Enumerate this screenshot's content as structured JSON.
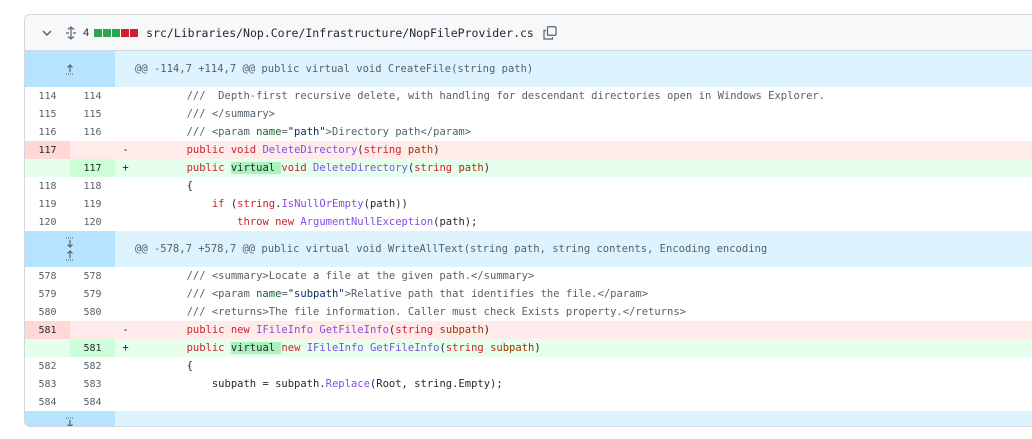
{
  "file": {
    "change_count": "4",
    "path": "src/Libraries/Nop.Core/Infrastructure/NopFileProvider.cs",
    "diffstat": [
      "add",
      "add",
      "add",
      "del",
      "del"
    ],
    "colors": {
      "add": "#2da44e",
      "del": "#cf222e",
      "hunk": "#ddf4ff"
    }
  },
  "hunks": [
    {
      "header": "@@ -114,7 +114,7 @@ public virtual void CreateFile(string path)",
      "lines": [
        {
          "type": "ctx",
          "old": "114",
          "new": "114",
          "marker": "",
          "tokens": [
            [
              "cm",
              "        ///  Depth-first recursive delete, with handling for descendant directories open in Windows Explorer."
            ]
          ]
        },
        {
          "type": "ctx",
          "old": "115",
          "new": "115",
          "marker": "",
          "tokens": [
            [
              "cm",
              "        /// </summary>"
            ]
          ]
        },
        {
          "type": "ctx",
          "old": "116",
          "new": "116",
          "marker": "",
          "tokens": [
            [
              "cm",
              "        /// <param "
            ],
            [
              "ent",
              "name"
            ],
            [
              "cm",
              "="
            ],
            [
              "str",
              "\"path\""
            ],
            [
              "cm",
              ">Directory path</param>"
            ]
          ]
        },
        {
          "type": "del",
          "old": "117",
          "new": "",
          "marker": "-",
          "tokens": [
            [
              "",
              "        "
            ],
            [
              "kw",
              "public"
            ],
            [
              "",
              " "
            ],
            [
              "kw",
              "void"
            ],
            [
              "",
              " "
            ],
            [
              "fn",
              "DeleteDirectory"
            ],
            [
              "",
              "("
            ],
            [
              "kw",
              "string"
            ],
            [
              "",
              " "
            ],
            [
              "ident",
              "path"
            ],
            [
              "",
              ")"
            ]
          ]
        },
        {
          "type": "add",
          "old": "",
          "new": "117",
          "marker": "+",
          "tokens": [
            [
              "",
              "        "
            ],
            [
              "kw",
              "public"
            ],
            [
              "",
              " "
            ],
            [
              "hl",
              "virtual "
            ],
            [
              "kw",
              "void"
            ],
            [
              "",
              " "
            ],
            [
              "fn",
              "DeleteDirectory"
            ],
            [
              "",
              "("
            ],
            [
              "kw",
              "string"
            ],
            [
              "",
              " "
            ],
            [
              "ident",
              "path"
            ],
            [
              "",
              ")"
            ]
          ]
        },
        {
          "type": "ctx",
          "old": "118",
          "new": "118",
          "marker": "",
          "tokens": [
            [
              "",
              "        {"
            ]
          ]
        },
        {
          "type": "ctx",
          "old": "119",
          "new": "119",
          "marker": "",
          "tokens": [
            [
              "",
              "            "
            ],
            [
              "kw",
              "if"
            ],
            [
              "",
              " ("
            ],
            [
              "kw",
              "string"
            ],
            [
              "",
              "."
            ],
            [
              "fn",
              "IsNullOrEmpty"
            ],
            [
              "",
              "(path))"
            ]
          ]
        },
        {
          "type": "ctx",
          "old": "120",
          "new": "120",
          "marker": "",
          "tokens": [
            [
              "",
              "                "
            ],
            [
              "kw",
              "throw"
            ],
            [
              "",
              " "
            ],
            [
              "kw",
              "new"
            ],
            [
              "",
              " "
            ],
            [
              "fn",
              "ArgumentNullException"
            ],
            [
              "",
              "(path);"
            ]
          ]
        }
      ]
    },
    {
      "header": "@@ -578,7 +578,7 @@ public virtual void WriteAllText(string path, string contents, Encoding encoding",
      "lines": [
        {
          "type": "ctx",
          "old": "578",
          "new": "578",
          "marker": "",
          "tokens": [
            [
              "cm",
              "        /// <summary>Locate a file at the given path.</summary>"
            ]
          ]
        },
        {
          "type": "ctx",
          "old": "579",
          "new": "579",
          "marker": "",
          "tokens": [
            [
              "cm",
              "        /// <param "
            ],
            [
              "ent",
              "name"
            ],
            [
              "cm",
              "="
            ],
            [
              "str",
              "\"subpath\""
            ],
            [
              "cm",
              ">Relative path that identifies the file.</param>"
            ]
          ]
        },
        {
          "type": "ctx",
          "old": "580",
          "new": "580",
          "marker": "",
          "tokens": [
            [
              "cm",
              "        /// <returns>The file information. Caller must check Exists property.</returns>"
            ]
          ]
        },
        {
          "type": "del",
          "old": "581",
          "new": "",
          "marker": "-",
          "tokens": [
            [
              "",
              "        "
            ],
            [
              "kw",
              "public"
            ],
            [
              "",
              " "
            ],
            [
              "kw",
              "new"
            ],
            [
              "",
              " "
            ],
            [
              "fn",
              "IFileInfo"
            ],
            [
              "",
              " "
            ],
            [
              "fn",
              "GetFileInfo"
            ],
            [
              "",
              "("
            ],
            [
              "kw",
              "string"
            ],
            [
              "",
              " "
            ],
            [
              "ident",
              "subpath"
            ],
            [
              "",
              ")"
            ]
          ]
        },
        {
          "type": "add",
          "old": "",
          "new": "581",
          "marker": "+",
          "tokens": [
            [
              "",
              "        "
            ],
            [
              "kw",
              "public"
            ],
            [
              "",
              " "
            ],
            [
              "hl",
              "virtual "
            ],
            [
              "kw",
              "new"
            ],
            [
              "",
              " "
            ],
            [
              "fn",
              "IFileInfo"
            ],
            [
              "",
              " "
            ],
            [
              "fn",
              "GetFileInfo"
            ],
            [
              "",
              "("
            ],
            [
              "kw",
              "string"
            ],
            [
              "",
              " "
            ],
            [
              "ident",
              "subpath"
            ],
            [
              "",
              ")"
            ]
          ]
        },
        {
          "type": "ctx",
          "old": "582",
          "new": "582",
          "marker": "",
          "tokens": [
            [
              "",
              "        {"
            ]
          ]
        },
        {
          "type": "ctx",
          "old": "583",
          "new": "583",
          "marker": "",
          "tokens": [
            [
              "",
              "            subpath = subpath."
            ],
            [
              "fn",
              "Replace"
            ],
            [
              "",
              "(Root, string.Empty);"
            ]
          ]
        },
        {
          "type": "ctx",
          "old": "584",
          "new": "584",
          "marker": "",
          "tokens": [
            [
              "",
              ""
            ]
          ]
        }
      ]
    }
  ]
}
